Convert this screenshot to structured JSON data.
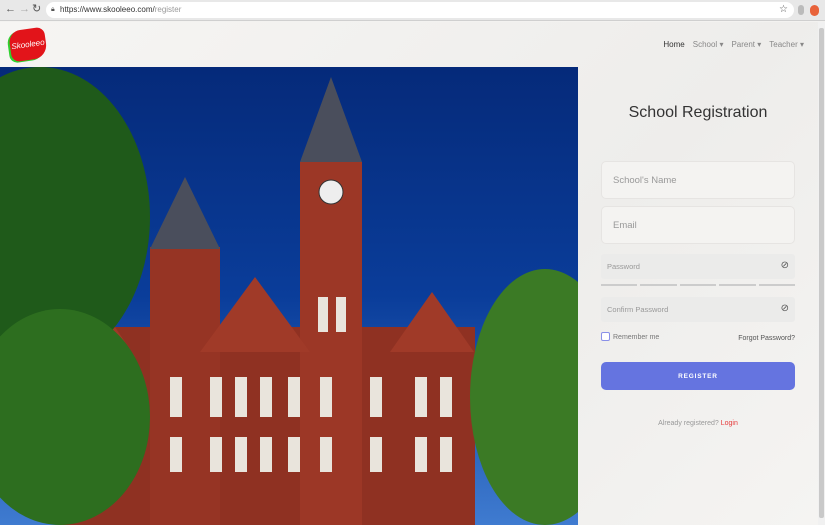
{
  "browser": {
    "url_host": "https://www.skooleeo.com/",
    "url_path": "register"
  },
  "logo": {
    "text": "Skooleeo"
  },
  "nav": {
    "home": "Home",
    "school": "School",
    "parent": "Parent",
    "teacher": "Teacher"
  },
  "form": {
    "title": "School Registration",
    "school_name_placeholder": "School's Name",
    "email_placeholder": "Email",
    "password_placeholder": "Password",
    "confirm_password_placeholder": "Confirm Password",
    "remember_label": "Remember me",
    "forgot_label": "Forgot Password?",
    "register_label": "REGISTER",
    "already_text": "Already registered?",
    "login_label": "Login"
  },
  "colors": {
    "accent": "#6574e0",
    "link": "#e53b3b"
  }
}
